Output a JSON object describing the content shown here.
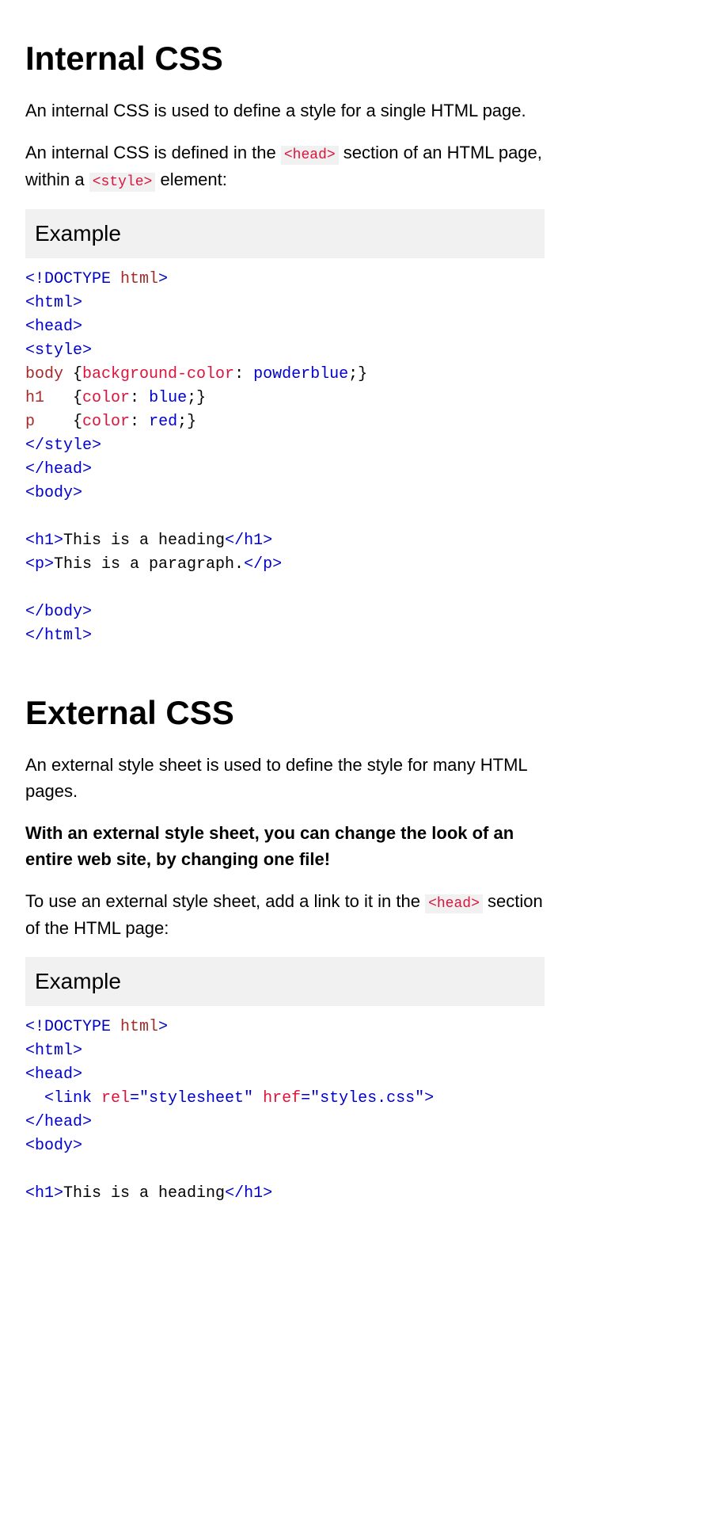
{
  "section1": {
    "title": "Internal CSS",
    "p1": "An internal CSS is used to define a style for a single HTML page.",
    "p2a": "An internal CSS is defined in the ",
    "code_head": "<head>",
    "p2b": " section of an HTML page, within a ",
    "code_style": "<style>",
    "p2c": " element:",
    "example_label": "Example",
    "code": {
      "l01a": "<!DOCTYPE",
      "l01b": " html",
      "l01c": ">",
      "l02": "<html>",
      "l03": "<head>",
      "l04": "<style>",
      "l05a": "body ",
      "l05b": "{",
      "l05c": "background-color",
      "l05d": ":",
      "l05e": " powderblue",
      "l05f": ";",
      "l05g": "}",
      "l06a": "h1   ",
      "l06b": "{",
      "l06c": "color",
      "l06d": ":",
      "l06e": " blue",
      "l06f": ";",
      "l06g": "}",
      "l07a": "p    ",
      "l07b": "{",
      "l07c": "color",
      "l07d": ":",
      "l07e": " red",
      "l07f": ";",
      "l07g": "}",
      "l08": "</style>",
      "l09": "</head>",
      "l10": "<body>",
      "l11a": "<h1>",
      "l11b": "This is a heading",
      "l11c": "</h1>",
      "l12a": "<p>",
      "l12b": "This is a paragraph.",
      "l12c": "</p>",
      "l13": "</body>",
      "l14": "</html>"
    }
  },
  "section2": {
    "title": "External CSS",
    "p1": "An external style sheet is used to define the style for many HTML pages.",
    "p2": "With an external style sheet, you can change the look of an entire web site, by changing one file!",
    "p3a": "To use an external style sheet, add a link to it in the ",
    "code_head": "<head>",
    "p3b": " section of the HTML page:",
    "example_label": "Example",
    "code": {
      "l01a": "<!DOCTYPE",
      "l01b": " html",
      "l01c": ">",
      "l02": "<html>",
      "l03": "<head>",
      "l04a": "  <link",
      "l04b": " rel",
      "l04c": "=\"stylesheet\"",
      "l04d": " href",
      "l04e": "=\"styles.css\"",
      "l04f": ">",
      "l05": "</head>",
      "l06": "<body>",
      "l07a": "<h1>",
      "l07b": "This is a heading",
      "l07c": "</h1>"
    }
  }
}
